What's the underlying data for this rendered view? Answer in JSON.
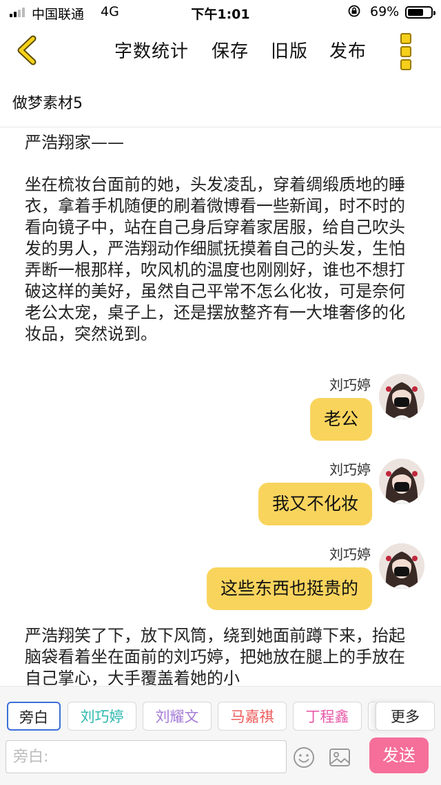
{
  "status_bar": {
    "carrier": "中国联通",
    "network": "4G",
    "time": "下午1:01",
    "battery": "69%",
    "battery_level": 0.69
  },
  "nav": {
    "word_count": "字数统计",
    "save": "保存",
    "old_version": "旧版",
    "publish": "发布"
  },
  "document": {
    "title": "做梦素材5"
  },
  "story": {
    "heading": "严浩翔家——",
    "para1": "坐在梳妆台面前的她，头发凌乱，穿着绸缎质地的睡衣，拿着手机随便的刷着微博看一些新闻，时不时的看向镜子中，站在自己身后穿着家居服，给自己吹头发的男人，严浩翔动作细腻抚摸着自己的头发，生怕弄断一根那样，吹风机的温度也刚刚好，谁也不想打破这样的美好，虽然自己平常不怎么化妆，可是奈何老公太宠，桌子上，还是摆放整齐有一大堆奢侈的化妆品，突然说到。",
    "messages": [
      {
        "name": "刘巧婷",
        "text": "老公"
      },
      {
        "name": "刘巧婷",
        "text": "我又不化妆"
      },
      {
        "name": "刘巧婷",
        "text": "这些东西也挺贵的"
      }
    ],
    "para2": "严浩翔笑了下，放下风筒，绕到她面前蹲下来，抬起脑袋看着坐在面前的刘巧婷，把她放在腿上的手放在自己掌心，大手覆盖着她的小"
  },
  "roles": {
    "narrator": "旁白",
    "role1": "刘巧婷",
    "role2": "刘耀文",
    "role3": "马嘉祺",
    "role4": "丁程鑫",
    "more": "更多"
  },
  "role_colors": {
    "narrator": "#3a6fd8",
    "role1": "#2fb8b0",
    "role2": "#a47bd6",
    "role3": "#ee5a5a",
    "role4": "#e85aa8"
  },
  "input": {
    "placeholder": "旁白:"
  },
  "send": "发送"
}
